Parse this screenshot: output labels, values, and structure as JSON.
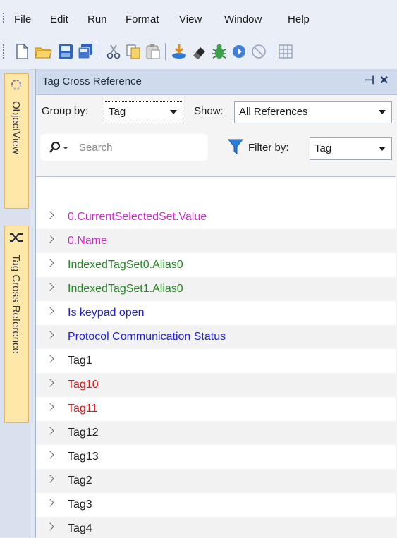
{
  "menu": [
    "File",
    "Edit",
    "Run",
    "Format",
    "View",
    "Window",
    "Help"
  ],
  "toolbar_icons": [
    "new-file-icon",
    "open-folder-icon",
    "save-icon",
    "save-all-icon",
    "cut-icon",
    "copy-icon",
    "paste-icon",
    "download-icon",
    "eraser-icon",
    "bug-icon",
    "run-icon",
    "stop-icon",
    "grid-icon"
  ],
  "side_tabs": {
    "object_view": "ObjectView",
    "tag_cross_reference": "Tag Cross Reference"
  },
  "panel": {
    "title": "Tag Cross Reference",
    "group_by_label": "Group by:",
    "group_by_value": "Tag",
    "show_label": "Show:",
    "show_value": "All References",
    "search_placeholder": "Search",
    "filter_label": "Filter by:",
    "filter_value": "Tag"
  },
  "tree": {
    "items": [
      {
        "label": "0.CurrentSelectedSet.Value",
        "color": "#e01ee0"
      },
      {
        "label": "0.Name",
        "color": "#e01ee0"
      },
      {
        "label": "IndexedTagSet0.Alias0",
        "color": "#1f8a1f"
      },
      {
        "label": "IndexedTagSet1.Alias0",
        "color": "#1f8a1f"
      },
      {
        "label": "Is keypad open",
        "color": "#2020d8"
      },
      {
        "label": "Protocol Communication Status",
        "color": "#2020d8"
      },
      {
        "label": "Tag1",
        "color": "#1e1e1e"
      },
      {
        "label": "Tag10",
        "color": "#e01414"
      },
      {
        "label": "Tag11",
        "color": "#e01414"
      },
      {
        "label": "Tag12",
        "color": "#1e1e1e"
      },
      {
        "label": "Tag13",
        "color": "#1e1e1e"
      },
      {
        "label": "Tag2",
        "color": "#1e1e1e"
      },
      {
        "label": "Tag3",
        "color": "#1e1e1e"
      },
      {
        "label": "Tag4",
        "color": "#1e1e1e"
      }
    ]
  }
}
